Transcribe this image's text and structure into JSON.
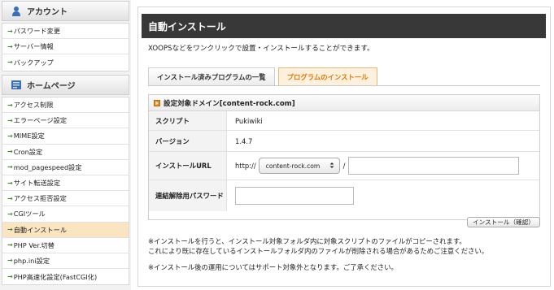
{
  "sidebar": {
    "account": {
      "title": "アカウント",
      "icon": "user-icon",
      "items": [
        "パスワード変更",
        "サーバー情報",
        "バックアップ"
      ]
    },
    "homepage": {
      "title": "ホームページ",
      "icon": "book-icon",
      "items": [
        "アクセス制限",
        "エラーページ設定",
        "MIME設定",
        "Cron設定",
        "mod_pagespeed設定",
        "サイト転送設定",
        "アクセス拒否設定",
        "CGIツール",
        "自動インストール",
        "PHP Ver.切替",
        "php.ini設定",
        "PHP高速化設定(FastCGI化)"
      ]
    },
    "arrow": "→"
  },
  "main": {
    "title": "自動インストール",
    "intro": "XOOPSなどをワンクリックで設置・インストールすることができます。",
    "tabs": [
      "インストール済みプログラムの一覧",
      "プログラムのインストール"
    ],
    "active_tab": 1,
    "panel_title": "設定対象ドメイン[content-rock.com]",
    "rows": {
      "script_label": "スクリプト",
      "script_value": "Pukiwiki",
      "version_label": "バージョン",
      "version_value": "1.4.7",
      "url_label": "インストールURL",
      "url_prefix": "http://",
      "url_domain": "content-rock.com",
      "url_separator": "/",
      "url_path_value": "",
      "password_label": "連結解除用パスワード",
      "password_value": ""
    },
    "confirm_button": "インストール（確認）",
    "note1": "※インストールを行うと、インストール対象フォルダ内に対象スクリプトのファイルがコピーされます。",
    "note2": "これにより既に存在しているインストールフォルダ内のファイルが削除される場合があるためご注意ください。",
    "note3": "※インストール後の運用についてはサポート対象外となります。ご了承ください。"
  },
  "colors": {
    "title_bar": "#383838",
    "accent": "#e0780a",
    "active_item": "#fbe4c0",
    "arrow": "#4a8a2a"
  }
}
